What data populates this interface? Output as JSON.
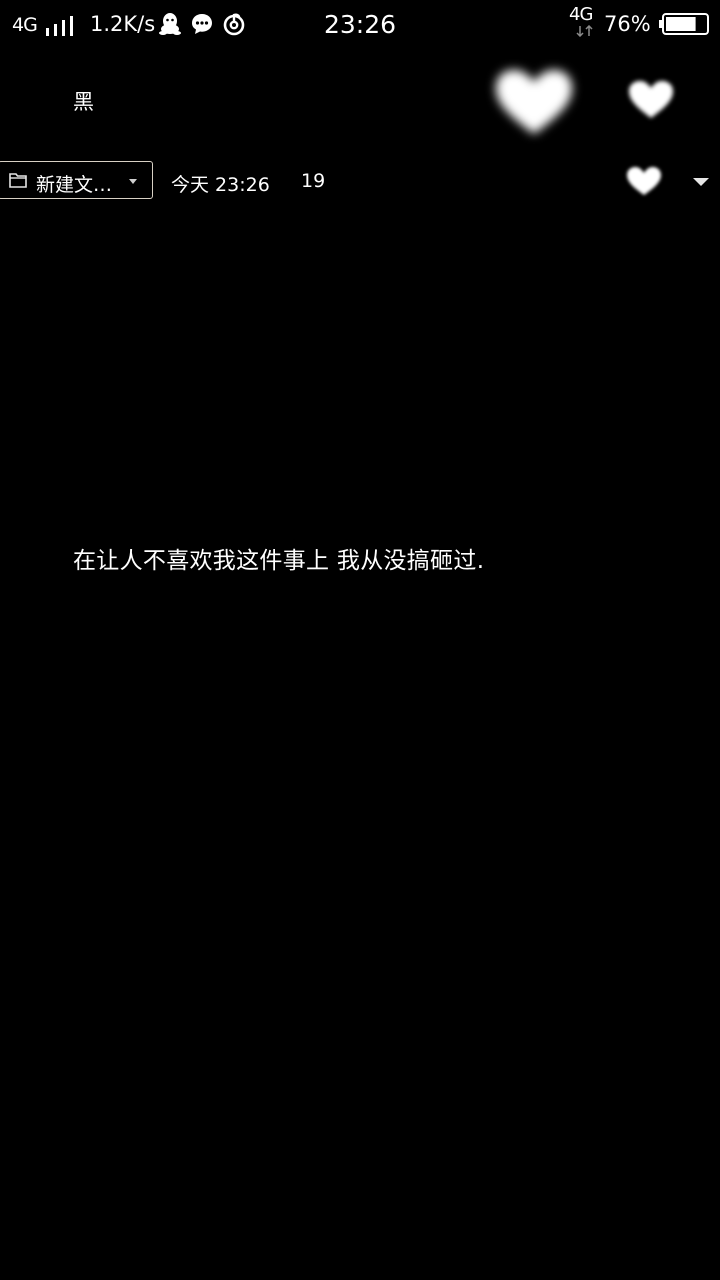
{
  "status_bar": {
    "network_left": "4G",
    "speed": "1.2K/s",
    "app_icons": [
      "qq-icon",
      "chat-icon",
      "netease-music-icon"
    ],
    "time": "23:26",
    "network_right": "4G",
    "battery_percent": "76%",
    "battery_level": 0.76
  },
  "header": {
    "title": "黑",
    "icons": [
      "glowing-heart-icon",
      "heart-icon"
    ]
  },
  "meta": {
    "folder_label": "新建文…",
    "date": "今天 23:26",
    "char_count": "19"
  },
  "note": {
    "body": "在让人不喜欢我这件事上 我从没搞砸过."
  },
  "colors": {
    "background": "#000000",
    "text": "#ffffff",
    "border": "#d8d1c5"
  }
}
